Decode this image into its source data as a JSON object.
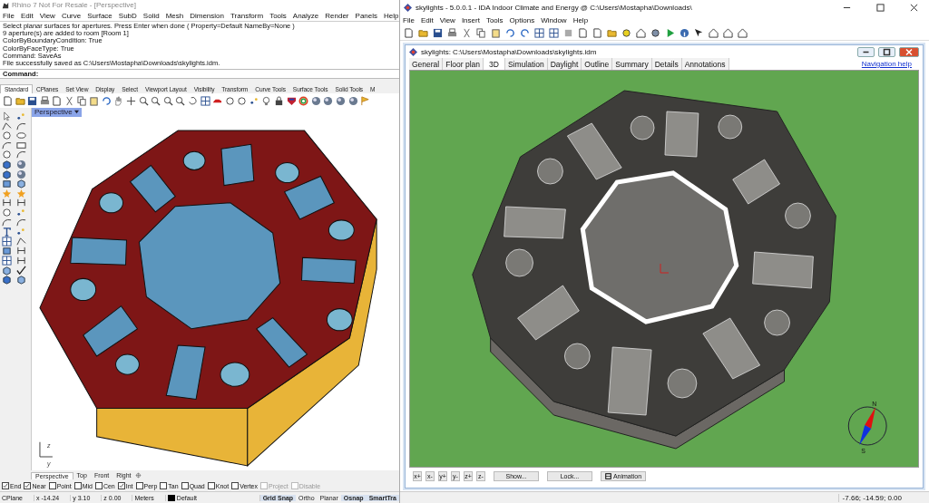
{
  "rhino": {
    "title": "Rhino 7 Not For Resale - [Perspective]",
    "menu": [
      "File",
      "Edit",
      "View",
      "Curve",
      "Surface",
      "SubD",
      "Solid",
      "Mesh",
      "Dimension",
      "Transform",
      "Tools",
      "Analyze",
      "Render",
      "Panels",
      "Help"
    ],
    "command_history": [
      "Select planar surfaces for apertures. Press Enter when done ( Property=Default  NameBy=None )",
      "9 aperture(s) are added to room [Room 1]",
      "ColorByBoundaryCondition: True",
      "ColorByFaceType: True",
      "Command: SaveAs",
      "File successfully saved as C:\\Users\\Mostapha\\Downloads\\skylights.idm."
    ],
    "command_prompt": "Command:",
    "toolbar_tabs": [
      {
        "label": "Standard",
        "selected": true
      },
      {
        "label": "CPlanes",
        "selected": false
      },
      {
        "label": "Set View",
        "selected": false
      },
      {
        "label": "Display",
        "selected": false
      },
      {
        "label": "Select",
        "selected": false
      },
      {
        "label": "Viewport Layout",
        "selected": false
      },
      {
        "label": "Visibility",
        "selected": false
      },
      {
        "label": "Transform",
        "selected": false
      },
      {
        "label": "Curve Tools",
        "selected": false
      },
      {
        "label": "Surface Tools",
        "selected": false
      },
      {
        "label": "Solid Tools",
        "selected": false
      },
      {
        "label": "M",
        "selected": false
      }
    ],
    "viewport": {
      "label": "Perspective",
      "axis_labels": [
        "z",
        "y"
      ]
    },
    "viewport_tabs": [
      {
        "label": "Perspective",
        "selected": true
      },
      {
        "label": "Top",
        "selected": false
      },
      {
        "label": "Front",
        "selected": false
      },
      {
        "label": "Right",
        "selected": false
      }
    ],
    "osnaps": [
      {
        "label": "End",
        "checked": true,
        "disabled": false
      },
      {
        "label": "Near",
        "checked": true,
        "disabled": false
      },
      {
        "label": "Point",
        "checked": false,
        "disabled": false
      },
      {
        "label": "Mid",
        "checked": false,
        "disabled": false
      },
      {
        "label": "Cen",
        "checked": false,
        "disabled": false
      },
      {
        "label": "Int",
        "checked": true,
        "disabled": false
      },
      {
        "label": "Perp",
        "checked": false,
        "disabled": false
      },
      {
        "label": "Tan",
        "checked": false,
        "disabled": false
      },
      {
        "label": "Quad",
        "checked": false,
        "disabled": false
      },
      {
        "label": "Knot",
        "checked": false,
        "disabled": false
      },
      {
        "label": "Vertex",
        "checked": false,
        "disabled": false
      },
      {
        "label": "Project",
        "checked": false,
        "disabled": true
      },
      {
        "label": "Disable",
        "checked": false,
        "disabled": true
      }
    ],
    "status_bar": {
      "fields": [
        "CPlane",
        "x -14.24",
        "y 3.10",
        "z 0.00",
        "Meters"
      ],
      "layer": {
        "label": "Default",
        "color": "#000000"
      },
      "toggles": [
        {
          "label": "Grid Snap",
          "on": true
        },
        {
          "label": "Ortho",
          "on": false
        },
        {
          "label": "Planar",
          "on": false
        },
        {
          "label": "Osnap",
          "on": true
        },
        {
          "label": "SmartTra",
          "on": true
        }
      ]
    }
  },
  "ida": {
    "title": "skylights - 5.0.0.1 - IDA Indoor Climate and Energy @ C:\\Users\\Mostapha\\Downloads\\",
    "menu": [
      "File",
      "Edit",
      "View",
      "Insert",
      "Tools",
      "Options",
      "Window",
      "Help"
    ],
    "document": {
      "title": "skylights: C:\\Users\\Mostapha\\Downloads\\skylights.idm",
      "tabs": [
        {
          "label": "General",
          "selected": false
        },
        {
          "label": "Floor plan",
          "selected": false
        },
        {
          "label": "3D",
          "selected": true
        },
        {
          "label": "Simulation",
          "selected": false
        },
        {
          "label": "Daylight",
          "selected": false
        },
        {
          "label": "Outline",
          "selected": false
        },
        {
          "label": "Summary",
          "selected": false
        },
        {
          "label": "Details",
          "selected": false
        },
        {
          "label": "Annotations",
          "selected": false
        }
      ],
      "help_link": "Navigation help",
      "compass": {
        "north": "N",
        "south": "S"
      },
      "view_buttons": [
        "x+",
        "x-",
        "y+",
        "y-",
        "z+",
        "z-"
      ],
      "buttons": [
        {
          "label": "Show...",
          "kind": "plain"
        },
        {
          "label": "Lock...",
          "kind": "plain"
        },
        {
          "label": "Animation",
          "kind": "film"
        }
      ]
    },
    "status_bar": "-7.66; -14.59; 0.00"
  }
}
